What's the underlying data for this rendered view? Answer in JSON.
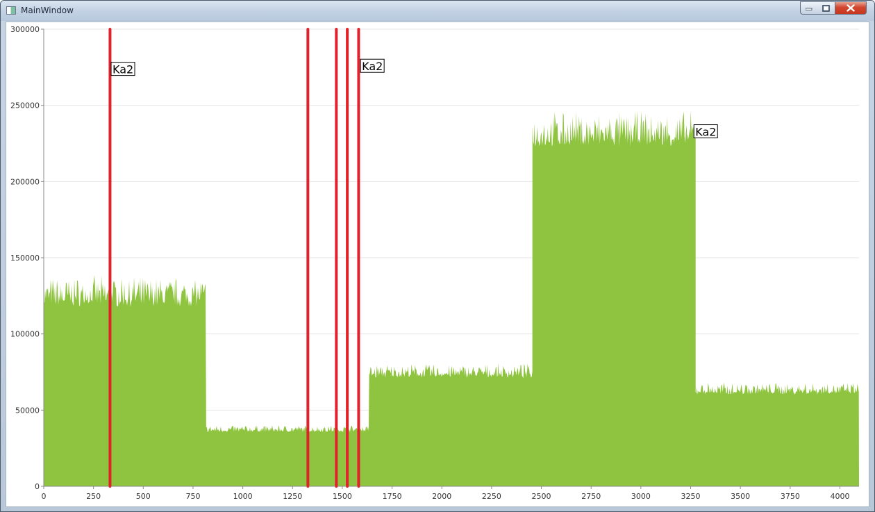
{
  "window": {
    "title": "MainWindow",
    "icon": "window-app-icon",
    "controls": [
      "minimize-icon",
      "maximize-icon",
      "close-icon"
    ]
  },
  "chart_data": {
    "type": "area",
    "title": "",
    "xlabel": "",
    "ylabel": "",
    "xlim": [
      0,
      4096
    ],
    "ylim": [
      0,
      300000
    ],
    "grid": "horizontal",
    "x_ticks": [
      0,
      250,
      500,
      750,
      1000,
      1250,
      1500,
      1750,
      2000,
      2250,
      2500,
      2750,
      3000,
      3250,
      3500,
      3750,
      4000
    ],
    "y_ticks": [
      0,
      50000,
      100000,
      150000,
      200000,
      250000,
      300000
    ],
    "series": [
      {
        "color": "#8fc440",
        "noisy": true,
        "segments": [
          {
            "x_start": 0,
            "x_end": 816,
            "base": 120000,
            "peak": 137000
          },
          {
            "x_start": 816,
            "x_end": 1635,
            "base": 36000,
            "peak": 40000
          },
          {
            "x_start": 1635,
            "x_end": 2455,
            "base": 72000,
            "peak": 80000
          },
          {
            "x_start": 2455,
            "x_end": 3275,
            "base": 225000,
            "peak": 245000
          },
          {
            "x_start": 3275,
            "x_end": 4096,
            "base": 61000,
            "peak": 68000
          }
        ]
      }
    ],
    "markers": {
      "color": "#e0232a",
      "x": [
        333,
        1327,
        1470,
        1525,
        1582
      ]
    },
    "annotations": [
      {
        "text": "Ka2",
        "x": 342,
        "y": 271000
      },
      {
        "text": "Ka2",
        "x": 1595,
        "y": 273000
      },
      {
        "text": "Ka2",
        "x": 3270,
        "y": 230000
      }
    ]
  }
}
